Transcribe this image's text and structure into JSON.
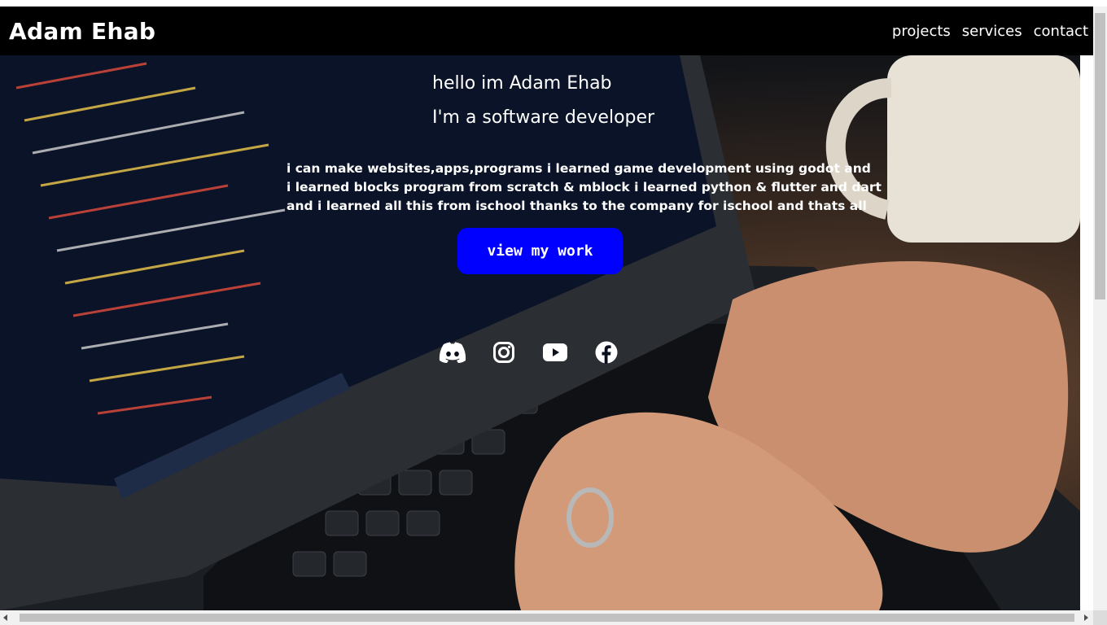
{
  "navbar": {
    "brand": "Adam Ehab",
    "links": [
      "projects",
      "services",
      "contact"
    ]
  },
  "hero": {
    "greeting": "hello im Adam Ehab",
    "role": "I'm a software developer",
    "bio_lines": [
      "i can make websites,apps,programs i learned game development using godot and",
      "i learned blocks program from scratch & mblock i learned python & flutter and dart",
      "and i learned all this from ischool thanks to the company for ischool and thats all"
    ],
    "cta_label": "view my work",
    "background_image": "laptop-typing-photo"
  },
  "socials": [
    {
      "name": "discord",
      "icon": "discord-icon"
    },
    {
      "name": "instagram",
      "icon": "instagram-icon"
    },
    {
      "name": "youtube",
      "icon": "youtube-icon"
    },
    {
      "name": "facebook",
      "icon": "facebook-icon"
    }
  ],
  "colors": {
    "navbar": "#000000",
    "cta": "#0000ff",
    "text": "#ffffff"
  }
}
